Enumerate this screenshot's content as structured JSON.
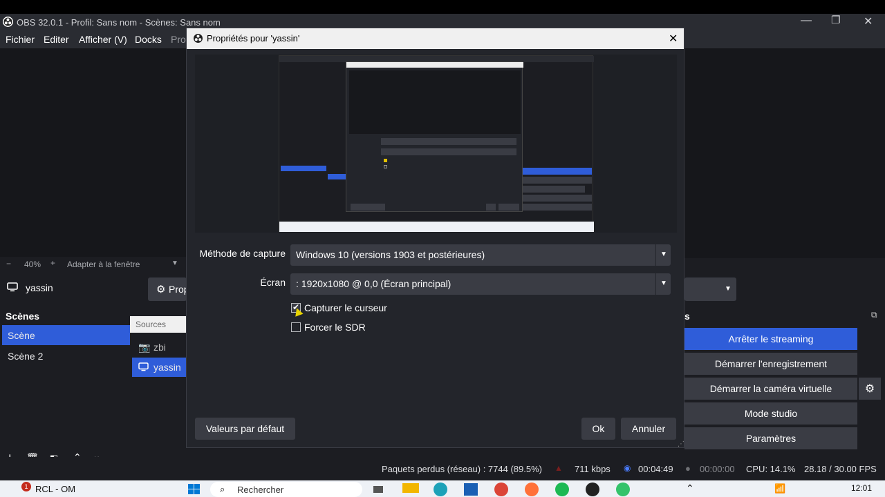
{
  "main": {
    "title": "OBS 32.0.1 - Profil: Sans nom - Scènes: Sans nom",
    "menu": [
      "Fichier",
      "Editer",
      "Afficher (V)",
      "Docks",
      "Pro"
    ],
    "zoom": {
      "minus": "−",
      "value": "40%",
      "plus": "+",
      "fit_label": "Adapter à la fenêtre"
    },
    "source_bar": {
      "source_name": "yassin",
      "properties_label": "Prop"
    },
    "scenes": {
      "title": "Scènes",
      "items": [
        "Scène",
        "Scène 2"
      ],
      "selected": 0
    },
    "sources": {
      "title": "Sources",
      "items": [
        {
          "name": "zbi",
          "icon": "camera-icon"
        },
        {
          "name": "yassin",
          "icon": "monitor-icon"
        }
      ],
      "selected": 1
    },
    "controls": {
      "title": "s",
      "buttons": [
        "Arrêter le streaming",
        "Démarrer l'enregistrement",
        "Démarrer la caméra virtuelle",
        "Mode studio",
        "Paramètres"
      ]
    },
    "status": {
      "dropped": "Paquets perdus (réseau) : 7744 (89.5%)",
      "bitrate": "711 kbps",
      "stream_time": "00:04:49",
      "rec_time": "00:00:00",
      "cpu": "CPU: 14.1%",
      "fps": "28.18 / 30.00 FPS"
    }
  },
  "dialog": {
    "title": "Propriétés pour 'yassin'",
    "capture_method_label": "Méthode de capture",
    "capture_method_value": "Windows 10 (versions 1903 et postérieures)",
    "screen_label": "Écran",
    "screen_value": ": 1920x1080 @ 0,0 (Écran principal)",
    "capture_cursor_label": "Capturer le curseur",
    "capture_cursor_checked": true,
    "force_sdr_label": "Forcer le SDR",
    "force_sdr_checked": false,
    "defaults_button": "Valeurs par défaut",
    "ok_button": "Ok",
    "cancel_button": "Annuler"
  },
  "taskbar": {
    "app_badge": "1",
    "app_label": "RCL - OM",
    "search_placeholder": "Rechercher",
    "clock": "12:01"
  },
  "colors": {
    "accent": "#2f5dd9",
    "background": "#1c1d22",
    "dialog": "#23252b",
    "button": "#3a3c44"
  }
}
